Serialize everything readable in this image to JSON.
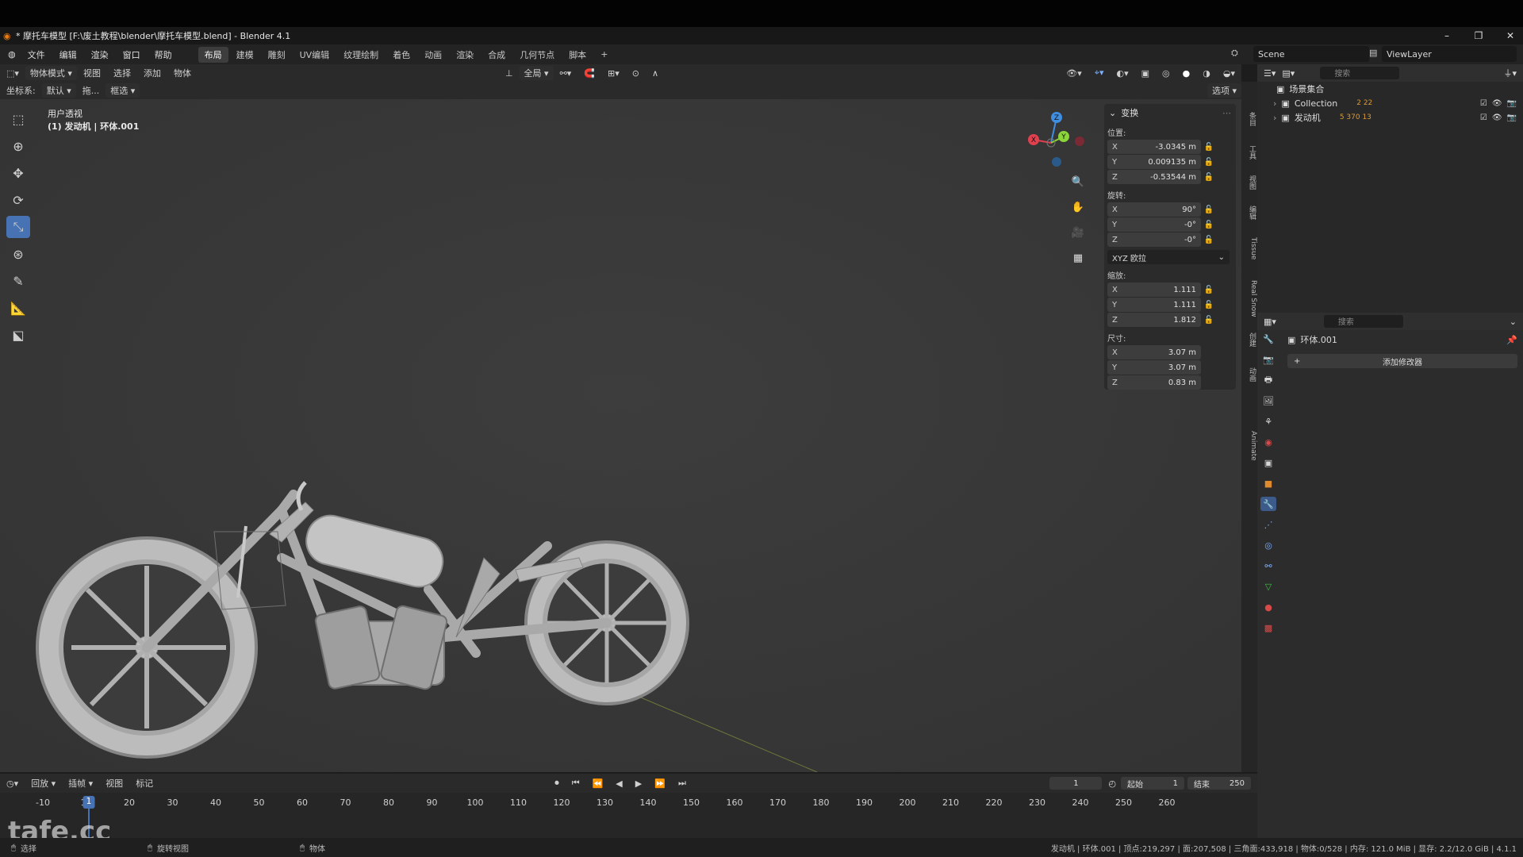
{
  "window": {
    "title": "* 摩托车模型 [F:\\废土教程\\blender\\摩托车模型.blend] - Blender 4.1",
    "controls": [
      "–",
      "❐",
      "✕"
    ]
  },
  "menu": {
    "items": [
      "文件",
      "编辑",
      "渲染",
      "窗口",
      "帮助"
    ],
    "workspaces": [
      "布局",
      "建模",
      "雕刻",
      "UV编辑",
      "纹理绘制",
      "着色",
      "动画",
      "渲染",
      "合成",
      "几何节点",
      "脚本",
      "+"
    ],
    "active_workspace_index": 0,
    "scene": "Scene",
    "view_layer": "ViewLayer"
  },
  "viewport_header": {
    "mode": "物体模式",
    "menus": [
      "视图",
      "选择",
      "添加",
      "物体"
    ],
    "transform_orientation": "全局",
    "options": "选项"
  },
  "viewport_header2": {
    "coord_label": "坐标系:",
    "coord_value": "默认",
    "drag": "拖...",
    "select": "框选"
  },
  "viewport_info": {
    "line1": "用户透视",
    "line2": "(1) 发动机 | 环体.001"
  },
  "npanel": {
    "section": "变换",
    "location_label": "位置:",
    "location": [
      {
        "axis": "X",
        "value": "-3.0345 m"
      },
      {
        "axis": "Y",
        "value": "0.009135 m"
      },
      {
        "axis": "Z",
        "value": "-0.53544 m"
      }
    ],
    "rotation_label": "旋转:",
    "rotation": [
      {
        "axis": "X",
        "value": "90°"
      },
      {
        "axis": "Y",
        "value": "-0°"
      },
      {
        "axis": "Z",
        "value": "-0°"
      }
    ],
    "rotation_mode": "XYZ 欧拉",
    "scale_label": "缩放:",
    "scale": [
      {
        "axis": "X",
        "value": "1.111"
      },
      {
        "axis": "Y",
        "value": "1.111"
      },
      {
        "axis": "Z",
        "value": "1.812"
      }
    ],
    "dimensions_label": "尺寸:",
    "dimensions": [
      {
        "axis": "X",
        "value": "3.07 m"
      },
      {
        "axis": "Y",
        "value": "3.07 m"
      },
      {
        "axis": "Z",
        "value": "0.83 m"
      }
    ]
  },
  "side_tabs": [
    "条目",
    "工具",
    "视图",
    "编辑",
    "Tissue",
    "Real Snow",
    "创建",
    "动画",
    "Animate"
  ],
  "outliner": {
    "search_placeholder": "搜索",
    "root": "场景集合",
    "items": [
      {
        "name": "Collection",
        "badge": "2 22"
      },
      {
        "name": "发动机",
        "badge": "5 370 13"
      }
    ]
  },
  "properties": {
    "search_placeholder": "搜索",
    "object_name": "环体.001",
    "add_modifier": "添加修改器"
  },
  "timeline": {
    "menus": [
      "回放",
      "插帧",
      "视图",
      "标记"
    ],
    "current_frame": "1",
    "start_label": "起始",
    "start": "1",
    "end_label": "结束",
    "end": "250",
    "ticks": [
      "-10",
      "10",
      "20",
      "30",
      "40",
      "50",
      "60",
      "70",
      "80",
      "90",
      "100",
      "110",
      "120",
      "130",
      "140",
      "150",
      "160",
      "170",
      "180",
      "190",
      "200",
      "210",
      "220",
      "230",
      "240",
      "250",
      "260"
    ],
    "cursor_label": "1"
  },
  "statusbar": {
    "left1": "选择",
    "left2": "旋转视图",
    "left3": "物体",
    "right": "发动机 | 环体.001 | 顶点:219,297 | 面:207,508 | 三角面:433,918 | 物体:0/528 | 内存: 121.0 MiB | 显存: 2.2/12.0 GiB | 4.1.1"
  },
  "watermark": "tafe.cc",
  "colors": {
    "accent": "#4772b3",
    "viewport_bg": "#393939",
    "axis_x": "#e2404f",
    "axis_y": "#8bd43a",
    "axis_z": "#3f8ee0"
  }
}
